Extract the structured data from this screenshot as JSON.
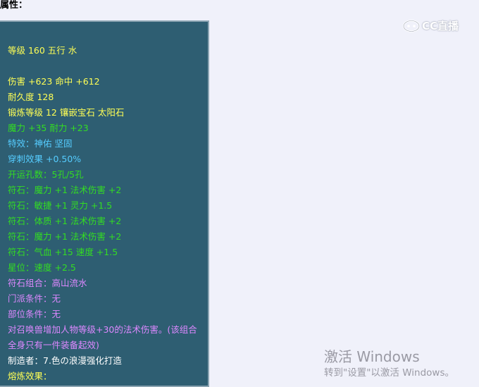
{
  "header": {
    "label": "属性："
  },
  "tooltip": {
    "lines": [
      {
        "text": "等级 160 五行 水",
        "color": "#ffff55"
      },
      {
        "text": "伤害 +623 命中 +612",
        "color": "#ffff55"
      },
      {
        "text": "耐久度 128",
        "color": "#ffff55"
      },
      {
        "text": "锻炼等级 12 镶嵌宝石 太阳石",
        "color": "#ffff55"
      },
      {
        "text": "魔力 +35 耐力 +23",
        "color": "#33dd22"
      },
      {
        "text": "特效：神佑 坚固",
        "color": "#55ccff"
      },
      {
        "text": "穿刺效果 +0.50%",
        "color": "#55ccff"
      },
      {
        "text": "开运孔数：5孔/5孔",
        "color": "#33dd22"
      },
      {
        "text": "符石：魔力 +1 法术伤害 +2",
        "color": "#33dd22"
      },
      {
        "text": "符石：敏捷 +1 灵力 +1.5",
        "color": "#33dd22"
      },
      {
        "text": "符石：体质 +1 法术伤害 +2",
        "color": "#33dd22"
      },
      {
        "text": "符石：魔力 +1 法术伤害 +2",
        "color": "#33dd22"
      },
      {
        "text": "符石：气血 +15 速度 +1.5",
        "color": "#33dd22"
      },
      {
        "text": "星位：速度 +2.5",
        "color": "#33dd22"
      },
      {
        "text": "符石组合：高山流水",
        "color": "#dd88ff"
      },
      {
        "text": "门派条件：无",
        "color": "#dd88ff"
      },
      {
        "text": "部位条件：无",
        "color": "#dd88ff"
      },
      {
        "text": "对召唤兽增加人物等级+30的法术伤害。(该组合全身只有一件装备起效)",
        "color": "#dd88ff"
      },
      {
        "text": "制造者：7.色の浪漫强化打造",
        "color": "#ffffff"
      },
      {
        "text": "熔炼效果：",
        "color": "#ffff55"
      }
    ]
  },
  "watermark": {
    "logo_text": "CC直播",
    "icon": "cc-logo-icon"
  },
  "os_notice": {
    "title": "激活 Windows",
    "subtitle": "转到\"设置\"以激活 Windows。"
  },
  "colors": {
    "panel_bg": "#2e5e72",
    "panel_border": "#8aa3b1",
    "page_bg": "#f0f1fa"
  }
}
